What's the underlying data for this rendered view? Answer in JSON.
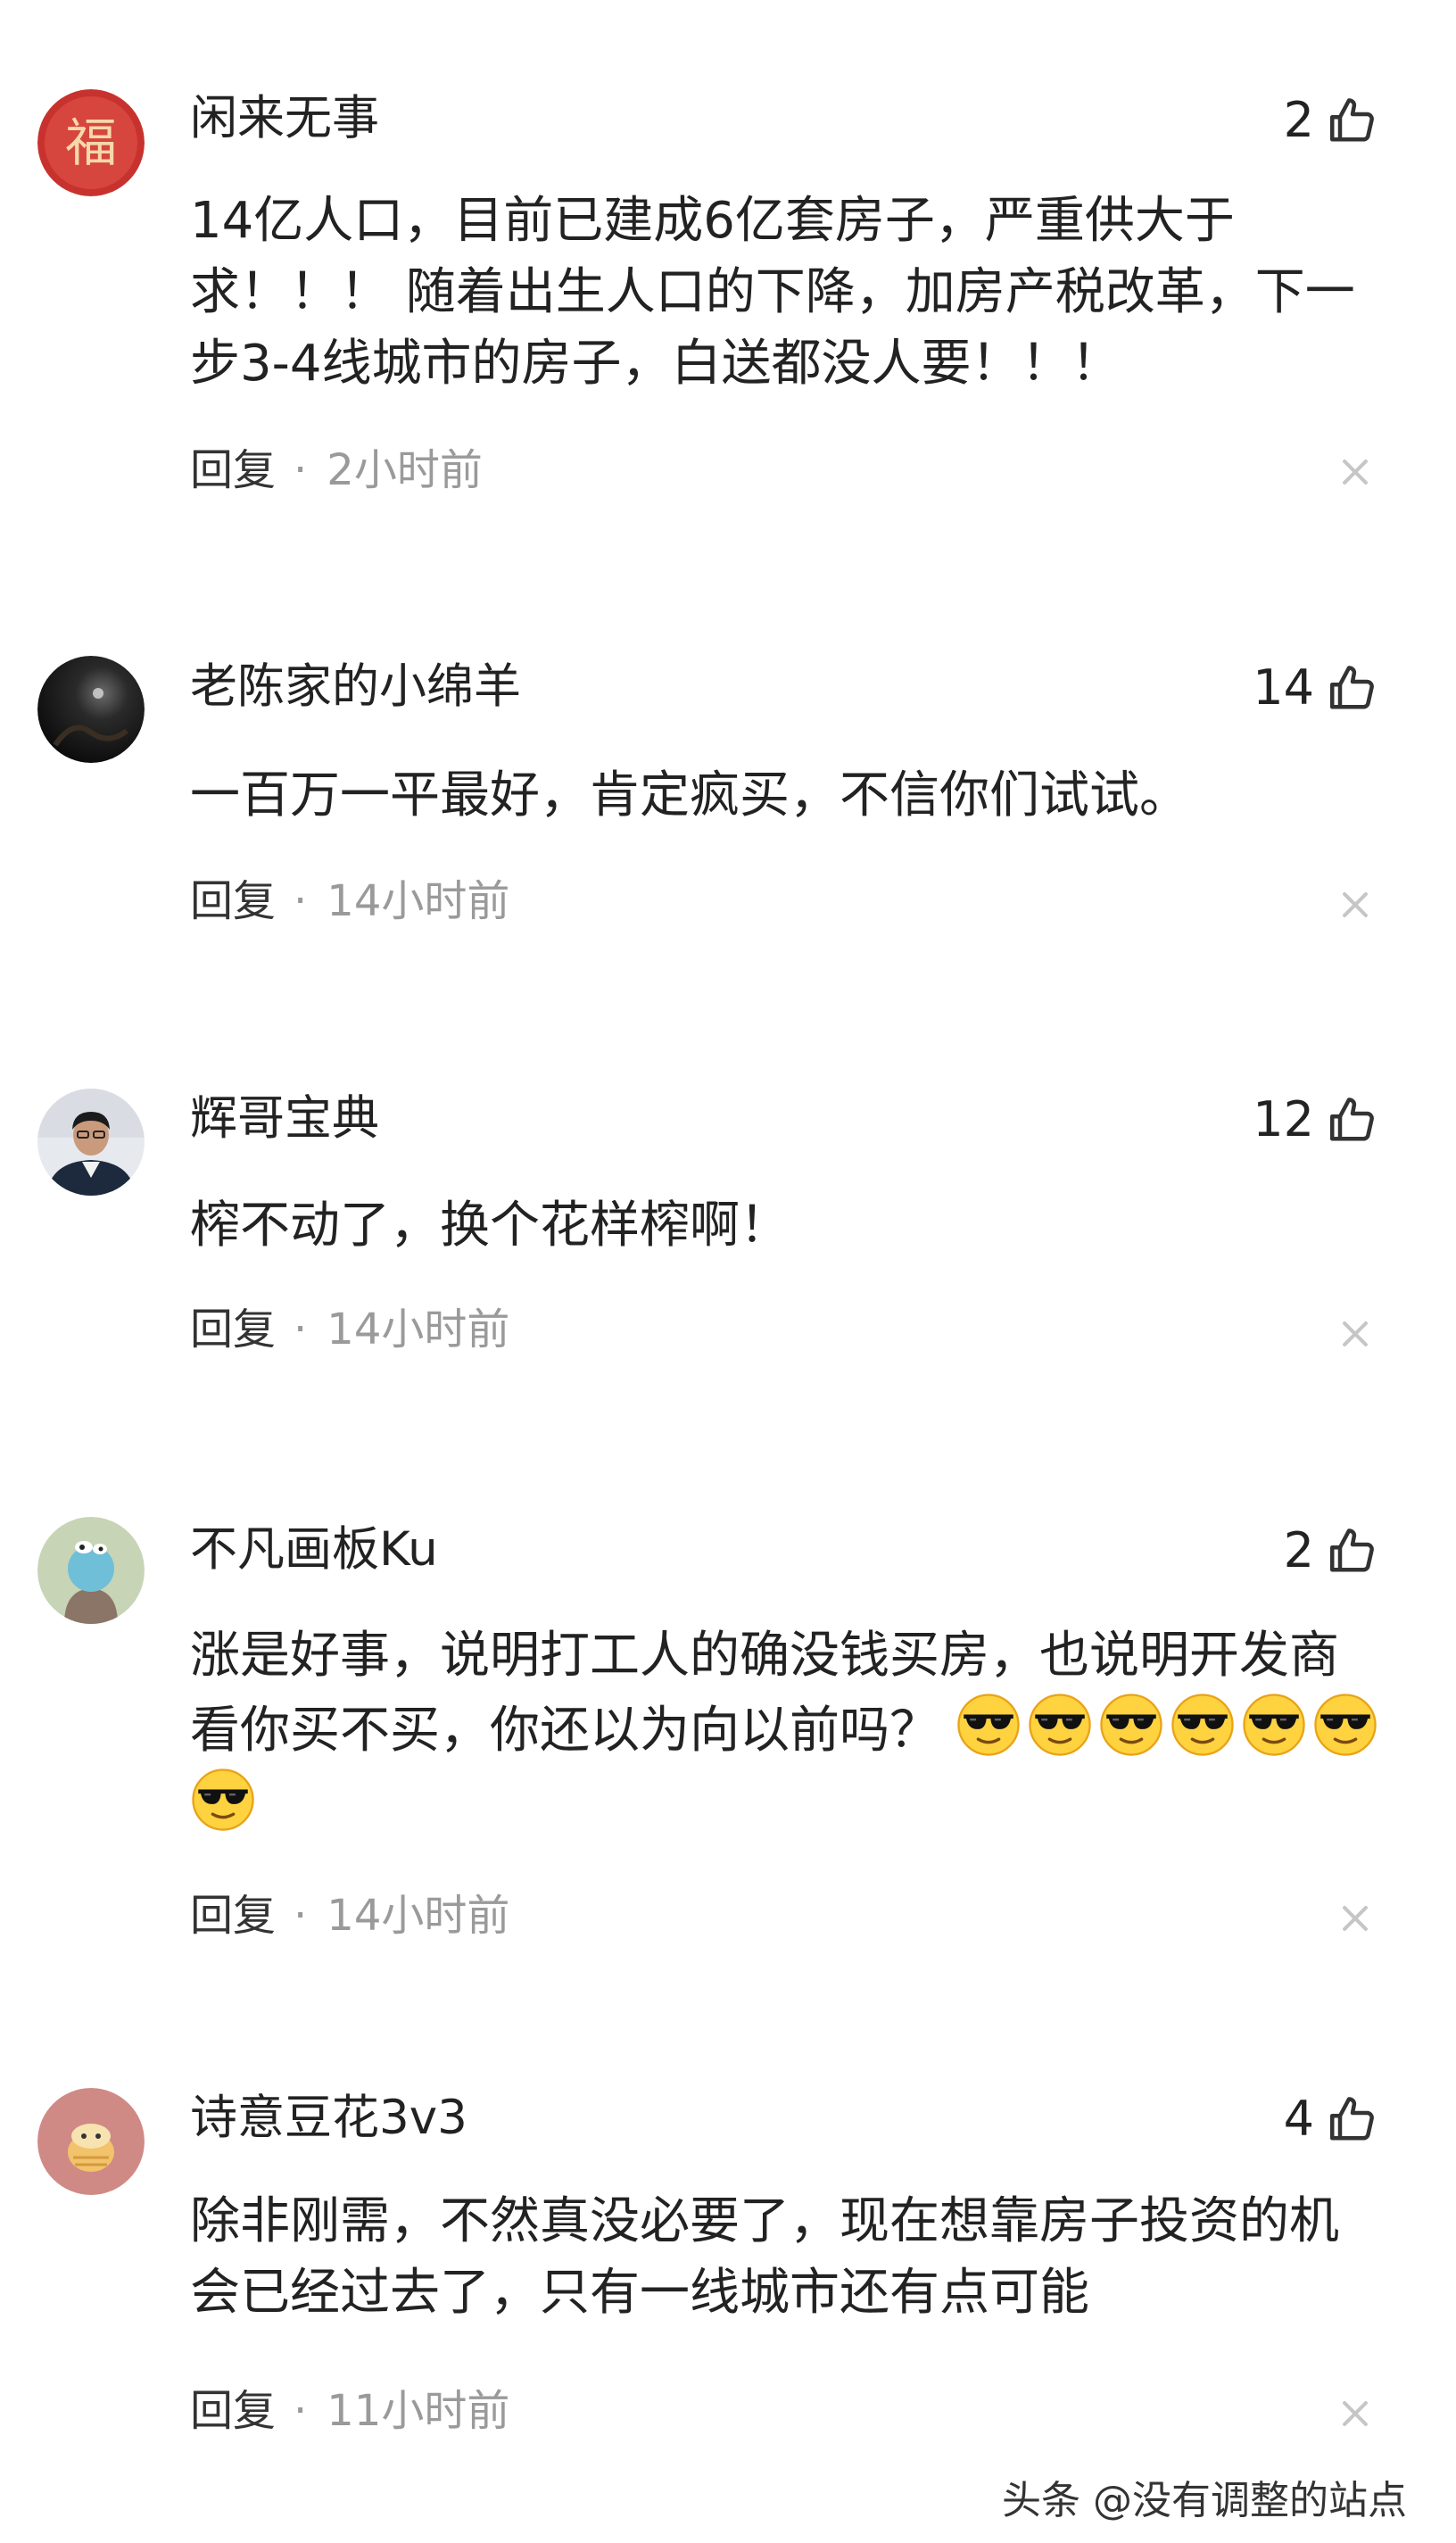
{
  "comments": [
    {
      "username": "闲来无事",
      "likes": "2",
      "lines": [
        "14亿人口，目前已建成6亿套房子，严重供大于",
        "求！！！ 随着出生人口的下降，加房产税改革，下一",
        "步3-4线城市的房子，白送都没人要！！！"
      ],
      "reply": "回复",
      "dot": "·",
      "time": "2小时前",
      "avatar": "fu-character-avatar"
    },
    {
      "username": "老陈家的小绵羊",
      "likes": "14",
      "lines": [
        "一百万一平最好，肯定疯买，不信你们试试。"
      ],
      "reply": "回复",
      "dot": "·",
      "time": "14小时前",
      "avatar": "dark-photo-avatar"
    },
    {
      "username": "辉哥宝典",
      "likes": "12",
      "lines": [
        "榨不动了，换个花样榨啊！"
      ],
      "reply": "回复",
      "dot": "·",
      "time": "14小时前",
      "avatar": "person-photo-avatar"
    },
    {
      "username": "不凡画板Ku",
      "likes": "2",
      "lines": [
        "涨是好事，说明打工人的确没钱买房，也说明开发商",
        "看你买不买，你还以为向以前吗？"
      ],
      "reply": "回复",
      "dot": "·",
      "time": "14小时前",
      "avatar": "cartoon-avatar",
      "emoji_name": "sunglasses-emoji"
    },
    {
      "username": "诗意豆花3v3",
      "likes": "4",
      "lines": [
        "除非刚需，不然真没必要了，现在想靠房子投资的机",
        "会已经过去了，只有一线城市还有点可能"
      ],
      "reply": "回复",
      "dot": "·",
      "time": "11小时前",
      "avatar": "bean-cartoon-avatar"
    }
  ],
  "watermark": "头条 @没有调整的站点",
  "colors": {
    "text": "#222222",
    "meta": "#9a9a9a",
    "fu_red": "#c8322e"
  }
}
